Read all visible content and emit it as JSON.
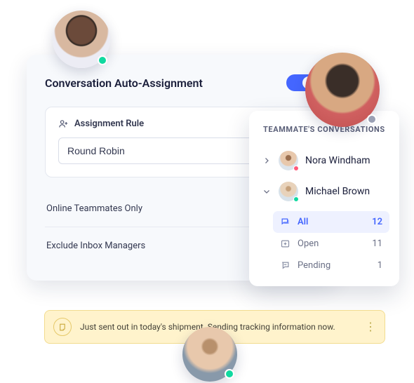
{
  "settings": {
    "title": "Conversation Auto-Assignment",
    "rule_label": "Assignment Rule",
    "rule_value": "Round Robin",
    "rows": [
      {
        "label": "Online Teammates Only"
      },
      {
        "label": "Exclude Inbox Managers"
      }
    ]
  },
  "teammates": {
    "title": "TEAMMATE'S CONVERSATIONS",
    "items": [
      {
        "name": "Nora Windham"
      },
      {
        "name": "Michael Brown"
      }
    ],
    "filters": [
      {
        "label": "All",
        "count": "12"
      },
      {
        "label": "Open",
        "count": "11"
      },
      {
        "label": "Pending",
        "count": "1"
      }
    ]
  },
  "toast": {
    "message": "Just sent out in today's shipment. Sending tracking information now."
  }
}
